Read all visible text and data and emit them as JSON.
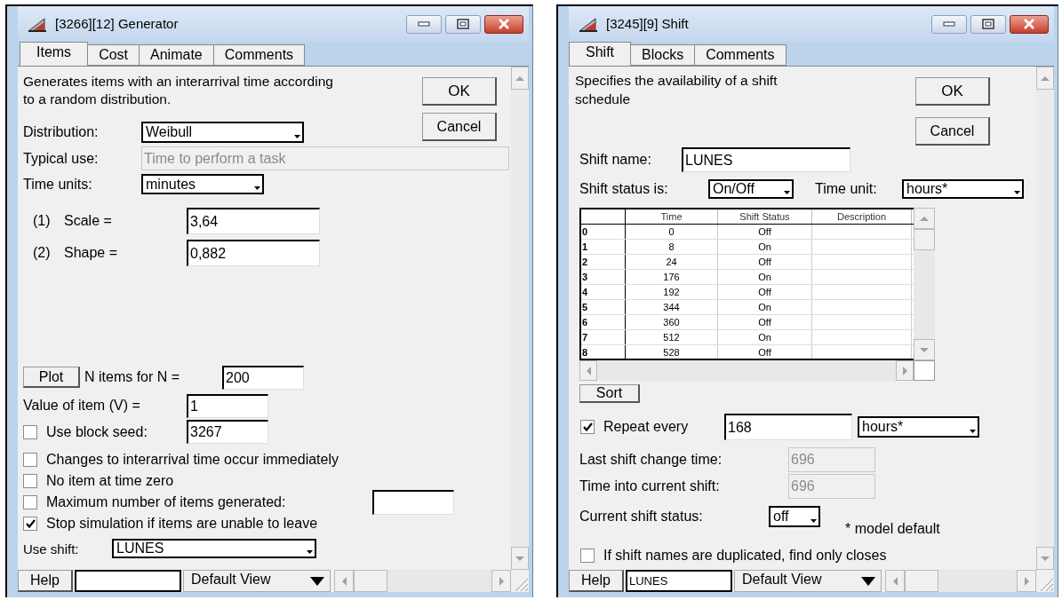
{
  "generator_window": {
    "title": "[3266][12]  Generator",
    "tabs": [
      {
        "label": "Items",
        "selected": true
      },
      {
        "label": "Cost",
        "selected": false
      },
      {
        "label": "Animate",
        "selected": false
      },
      {
        "label": "Comments",
        "selected": false
      }
    ],
    "description": "Generates items with an interarrival time according\nto a random distribution.",
    "ok_button": "OK",
    "cancel_button": "Cancel",
    "distribution": {
      "label": "Distribution:",
      "value": "Weibull"
    },
    "typical_use": {
      "label": "Typical use:",
      "value": "Time to perform a task",
      "disabled": true
    },
    "time_units": {
      "label": "Time units:",
      "value": "minutes"
    },
    "parameters": [
      {
        "index": "(1)",
        "label": "Scale =",
        "value": "3,64"
      },
      {
        "index": "(2)",
        "label": "Shape =",
        "value": "0,882"
      }
    ],
    "plot_button": "Plot",
    "n_items": {
      "label": "N items for N =",
      "value": "200"
    },
    "item_value": {
      "label": "Value of item (V) =",
      "value": "1"
    },
    "block_seed": {
      "label": "Use block seed:",
      "checked": false,
      "value": "3267"
    },
    "options": [
      {
        "kind": "checkbox",
        "label": "Changes to interarrival time occur immediately",
        "checked": false
      },
      {
        "kind": "checkbox",
        "label": "No item at time zero",
        "checked": false
      },
      {
        "kind": "checkbox_field",
        "label": "Maximum number of items generated:",
        "checked": false
      },
      {
        "kind": "checkbox",
        "label": "Stop simulation if items are unable to leave",
        "checked": true
      }
    ],
    "use_shift": {
      "label": "Use shift:",
      "value": "LUNES"
    },
    "bottom_bar": {
      "help_button": "Help",
      "view": "Default View"
    }
  },
  "shift_window": {
    "title": "[3245][9]  Shift",
    "tabs": [
      {
        "label": "Shift",
        "selected": true
      },
      {
        "label": "Blocks",
        "selected": false
      },
      {
        "label": "Comments",
        "selected": false
      }
    ],
    "description": "Specifies the availability of a shift\nschedule",
    "ok_button": "OK",
    "cancel_button": "Cancel",
    "shift_name": {
      "label": "Shift name:",
      "value": "LUNES"
    },
    "shift_status": {
      "label": "Shift status is:",
      "value": "On/Off"
    },
    "time_unit": {
      "label": "Time unit:",
      "value": "hours*"
    },
    "table": {
      "columns": [
        "Time",
        "Shift Status",
        "Description"
      ],
      "rows": [
        {
          "index": "0",
          "time": "0",
          "status": "Off"
        },
        {
          "index": "1",
          "time": "8",
          "status": "On"
        },
        {
          "index": "2",
          "time": "24",
          "status": "Off"
        },
        {
          "index": "3",
          "time": "176",
          "status": "On"
        },
        {
          "index": "4",
          "time": "192",
          "status": "Off"
        },
        {
          "index": "5",
          "time": "344",
          "status": "On"
        },
        {
          "index": "6",
          "time": "360",
          "status": "Off"
        },
        {
          "index": "7",
          "time": "512",
          "status": "On"
        },
        {
          "index": "8",
          "time": "528",
          "status": "Off"
        }
      ]
    },
    "sort_button": "Sort",
    "repeat": {
      "label": "Repeat every",
      "checked": true,
      "value": "168",
      "unit": "hours*"
    },
    "last_change": {
      "label": "Last shift change time:",
      "value": "696",
      "disabled": true
    },
    "time_into": {
      "label": "Time into current shift:",
      "value": "696",
      "disabled": true
    },
    "current_status": {
      "label": "Current shift status:",
      "value": "off"
    },
    "note": "* model default",
    "find_closest": {
      "label": "If shift names are duplicated, find only closes",
      "checked": false
    },
    "bottom_bar": {
      "help_button": "Help",
      "name_field": "LUNES",
      "view": "Default View"
    }
  }
}
